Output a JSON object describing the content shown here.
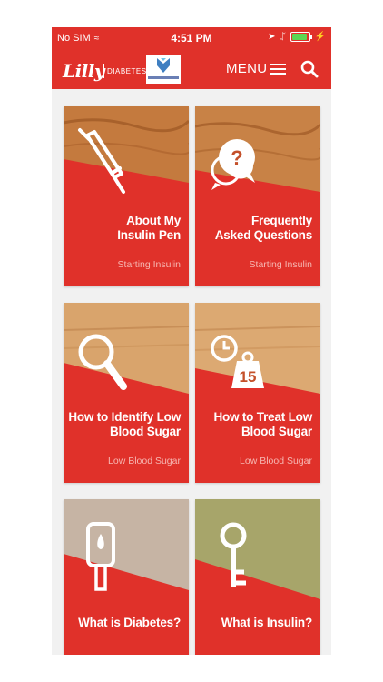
{
  "status": {
    "carrier": "No SIM",
    "time": "4:51 PM"
  },
  "header": {
    "logo": "Lilly",
    "logo_sub": "DIABETES",
    "menu_label": "MENU"
  },
  "tiles": [
    {
      "title_line1": "About My",
      "title_line2": "Insulin Pen",
      "category": "Starting Insulin",
      "icon": "insulin-pen-icon"
    },
    {
      "title_line1": "Frequently",
      "title_line2": "Asked Questions",
      "category": "Starting Insulin",
      "icon": "question-bubble-icon"
    },
    {
      "title_line1": "How to Identify Low",
      "title_line2": "Blood Sugar",
      "category": "Low Blood Sugar",
      "icon": "magnifier-icon"
    },
    {
      "title_line1": "How to Treat Low",
      "title_line2": "Blood Sugar",
      "category": "Low Blood Sugar",
      "icon": "clock-weight-icon",
      "icon_text": "15"
    },
    {
      "title_line1": "What is Diabetes?",
      "icon": "glucose-meter-icon"
    },
    {
      "title_line1": "What is Insulin?",
      "icon": "key-icon"
    }
  ],
  "colors": {
    "brand_red": "#e0312a",
    "wood": "#c47a3e",
    "wood_light": "#d9a46c",
    "paper": "#c6b4a4",
    "fabric": "#a7a56a"
  }
}
